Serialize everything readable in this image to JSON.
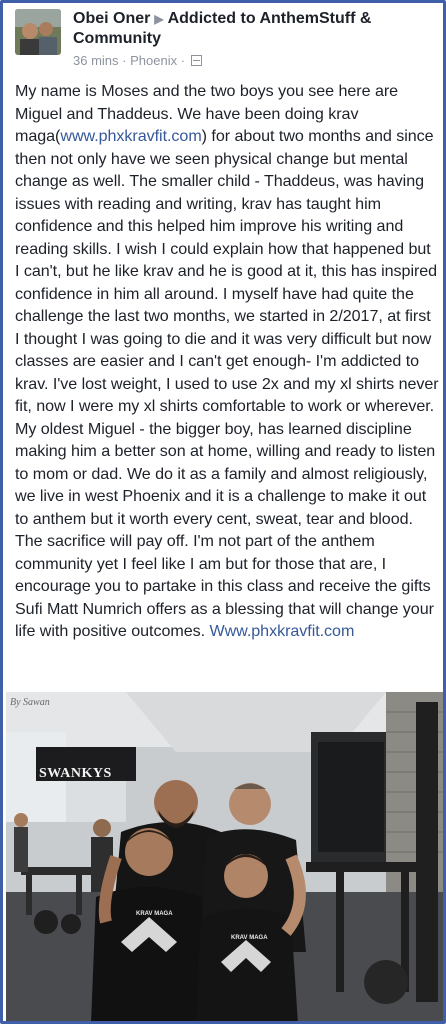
{
  "post": {
    "author": "Obei Oner",
    "group": "Addicted to AnthemStuff & Community",
    "time": "36 mins",
    "location": "Phoenix",
    "separator": "·"
  },
  "content": {
    "p1": "My name is Moses and the two boys you see here are Miguel and Thaddeus. We have been doing krav maga(",
    "link1": "www.phxkravfit.com",
    "p2": ") for about two months and since then not only have we seen physical change but mental change as well. The smaller child - Thaddeus, was having issues with reading and writing, krav has taught him confidence and this helped him improve his writing and reading skills. I wish I could explain how that happened but I can't, but he like krav and he is good at it, this has inspired confidence in him all around. I myself have had quite the challenge the last two months, we started in 2/2017, at first I thought I was going to die and it was very difficult but now classes are easier and I can't get enough- I'm addicted to krav. I've lost weight, I used to use 2x and my xl shirts never fit, now I were my xl shirts comfortable to work or wherever. My oldest Miguel - the bigger boy, has learned discipline making him a better son at home, willing and ready to listen to mom or dad. We do it as a family and almost religiously, we live in west Phoenix and it is a challenge to make it out to anthem but it worth every cent, sweat, tear and blood. The sacrifice will pay off. I'm not part of the anthem community yet I feel like I am but for those that are, I encourage you to partake in this class and receive the gifts Sufi Matt Numrich offers as a blessing that will change your life with positive outcomes. ",
    "link2": "Www.phxkravfit.com"
  },
  "photo": {
    "watermark": "By Sawan",
    "sign": "SWANKYS",
    "shirt_text": "KRAV MAGA"
  },
  "colors": {
    "border": "#3f5fa8",
    "link": "#365899",
    "text": "#1d2129",
    "meta": "#8d949e"
  }
}
